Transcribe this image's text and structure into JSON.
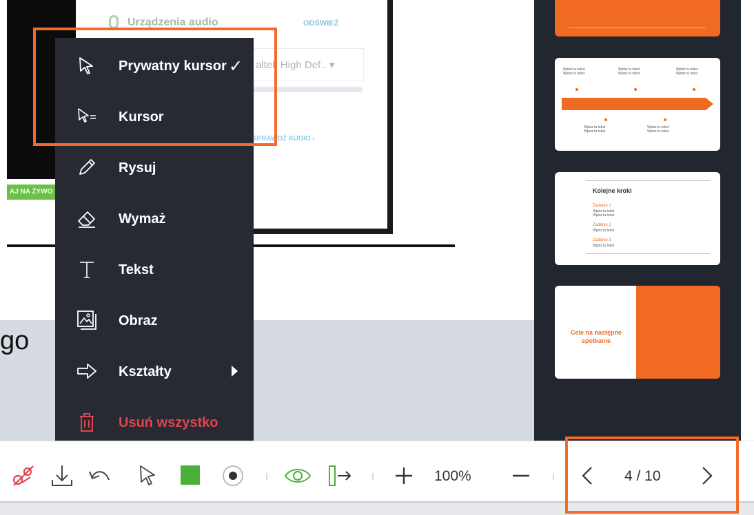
{
  "background": {
    "audio_title": "Urządzenia audio",
    "refresh_label": "ODŚWIEŻ",
    "device_select": "altek High Def..  ▾",
    "test_link": "SPRAWDŹ AUDIO ›",
    "live_button": "AJ NA ŻYWO",
    "partial_text": "go"
  },
  "menu": {
    "items": [
      {
        "label": "Prywatny kursor",
        "icon": "private-cursor-icon",
        "checked": true
      },
      {
        "label": "Kursor",
        "icon": "cursor-icon"
      },
      {
        "label": "Rysuj",
        "icon": "pencil-icon"
      },
      {
        "label": "Wymaż",
        "icon": "eraser-icon"
      },
      {
        "label": "Tekst",
        "icon": "text-icon"
      },
      {
        "label": "Obraz",
        "icon": "image-icon"
      },
      {
        "label": "Kształty",
        "icon": "arrow-shape-icon",
        "has_submenu": true
      },
      {
        "label": "Usuń wszystko",
        "icon": "trash-icon",
        "danger": true
      }
    ],
    "check_mark": "✓"
  },
  "thumbnails": {
    "slide3_title": "Kolejne kroki",
    "slide3_items": [
      "Zadanie 1",
      "Zadanie 2",
      "Zadanie 3"
    ],
    "slide4_title": "Cele na następne spotkanie"
  },
  "toolbar": {
    "zoom_level": "100%",
    "page_indicator": "4 / 10",
    "icons": [
      "laser-pointer-icon",
      "download-icon",
      "undo-icon",
      "cursor-icon",
      "color-swatch-icon",
      "stroke-size-icon",
      "eye-icon",
      "exit-presentation-icon",
      "zoom-in-icon",
      "zoom-out-icon",
      "prev-page-icon",
      "next-page-icon"
    ]
  },
  "colors": {
    "accent": "#f26b2a",
    "menu_bg": "#272a33",
    "danger": "#e0454f",
    "swatch": "#4caf38",
    "eye": "#4caf38"
  }
}
